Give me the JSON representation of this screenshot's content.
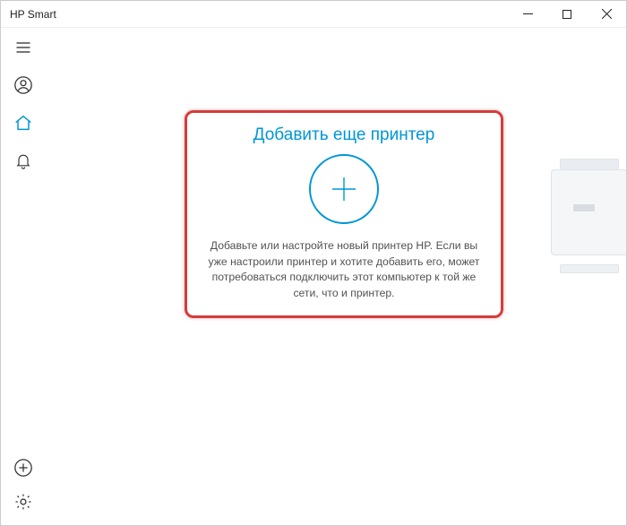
{
  "window": {
    "title": "HP Smart"
  },
  "sidebar": {
    "items": [
      {
        "name": "menu"
      },
      {
        "name": "account"
      },
      {
        "name": "home"
      },
      {
        "name": "notifications"
      }
    ],
    "bottom": [
      {
        "name": "add"
      },
      {
        "name": "settings"
      }
    ]
  },
  "main": {
    "card": {
      "title": "Добавить еще принтер",
      "description": "Добавьте или настройте новый принтер HP. Если вы уже настроили принтер и хотите добавить его, может потребоваться подключить этот компьютер к той же сети, что и принтер."
    }
  }
}
